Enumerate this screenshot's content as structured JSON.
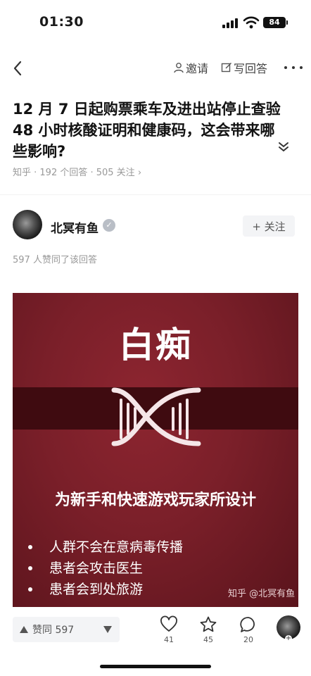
{
  "status_bar": {
    "time": "01:30",
    "battery": "84"
  },
  "nav": {
    "invite_label": "邀请",
    "write_answer_label": "写回答"
  },
  "question": {
    "title": "12 月 7 日起购票乘车及进出站停止查验 48 小时核酸证明和健康码，这会带来哪些影响?",
    "meta": "知乎 · 192 个回答 · 505 关注 ›"
  },
  "author": {
    "name": "北冥有鱼",
    "follow_label": "+ 关注"
  },
  "answer": {
    "upvote_summary": "597 人赞同了该回答",
    "image": {
      "title": "白痴",
      "subtitle": "为新手和快速游戏玩家所设计",
      "bullets": [
        "人群不会在意病毒传播",
        "患者会攻击医生",
        "患者会到处旅游"
      ],
      "watermark": "知乎 @北冥有鱼"
    }
  },
  "bottom_bar": {
    "upvote_label": "赞同 597",
    "comments_count": "41",
    "favorites_count": "45",
    "replies_count": "20"
  },
  "icons": [
    "back-icon",
    "person-icon",
    "edit-icon",
    "more-icon",
    "chevron-down-icon",
    "dna-icon",
    "heart-icon",
    "star-icon",
    "comment-icon"
  ],
  "colors": {
    "image_bg": "#7a1f29",
    "band": "#3f0b10",
    "meta_gray": "#999999"
  }
}
